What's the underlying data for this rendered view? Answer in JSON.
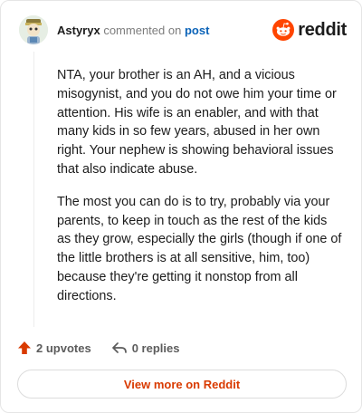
{
  "comment": {
    "username": "Astyryx",
    "action_text": "commented on",
    "post_link": "post",
    "paragraphs": [
      "NTA, your brother is an AH, and a vicious misogynist, and you do not owe him your time or attention. His wife is an enabler, and with that many kids in so few years, abused in her own right. Your nephew is showing behavioral issues that also indicate abuse.",
      "The most you can do is to try, probably via your parents, to keep in touch as the rest of the kids as they grow, especially the girls (though if one of the little brothers is at all sensitive, him, too) because they're getting it nonstop from all directions."
    ]
  },
  "brand": {
    "name": "reddit",
    "color": "#ff4500"
  },
  "actions": {
    "upvotes": "2 upvotes",
    "replies": "0 replies",
    "upvote_color": "#d93a00"
  },
  "view_more": "View more on Reddit"
}
